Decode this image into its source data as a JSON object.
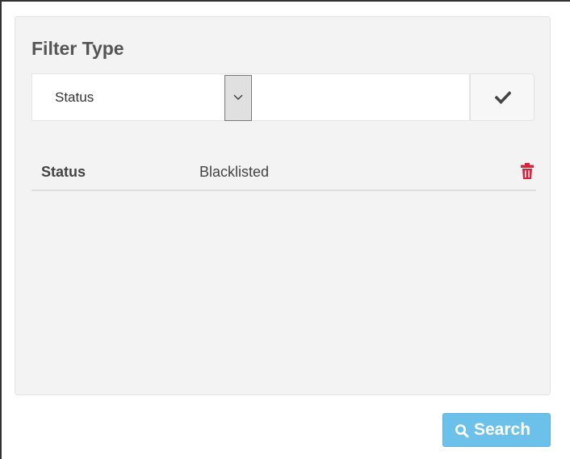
{
  "panel": {
    "title": "Filter Type"
  },
  "filter_form": {
    "type_select": {
      "selected": "Status",
      "options": [
        "Status"
      ]
    },
    "value_input": {
      "value": "",
      "placeholder": ""
    },
    "apply_icon": "checkmark-icon"
  },
  "active_filters": [
    {
      "key": "Status",
      "value": "Blacklisted",
      "remove_icon": "trash-icon"
    }
  ],
  "search_button": {
    "label": "Search",
    "icon": "search-icon"
  },
  "colors": {
    "panel_background": "#f3f3f3",
    "search_button": "#6cc1ea",
    "delete_icon": "#d9213a",
    "checkmark": "#444444"
  }
}
